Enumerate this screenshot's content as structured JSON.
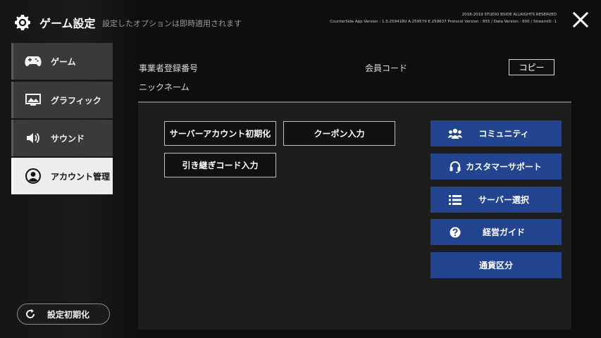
{
  "header": {
    "title": "ゲーム設定",
    "subtitle": "設定したオプションは即時適用されます",
    "copyright": "2018-2019 STUDIO BSIDE ALLRIGHTS RESERVED",
    "version": "CounterSide App Version : 1.0.259418U A.259579 E.259637 Protocol Version : 855 / Data Version : 600 / StreamID -1"
  },
  "sidebar": {
    "items": [
      {
        "label": "ゲーム",
        "icon": "gamepad-icon"
      },
      {
        "label": "グラフィック",
        "icon": "monitor-icon"
      },
      {
        "label": "サウンド",
        "icon": "speaker-icon"
      },
      {
        "label": "アカウント管理",
        "icon": "account-icon",
        "active": true
      }
    ],
    "reset_label": "設定初期化"
  },
  "account": {
    "business_number_label": "事業者登録番号",
    "member_code_label": "会員コード",
    "nickname_label": "ニックネーム",
    "copy_label": "コピー"
  },
  "actions": {
    "server_account_reset": "サーバーアカウント初期化",
    "coupon_input": "クーポン入力",
    "transfer_code_input": "引き継ぎコード入力"
  },
  "links": [
    {
      "label": "コミュニティ",
      "icon": "community-icon"
    },
    {
      "label": "カスタマーサポート",
      "icon": "headset-icon"
    },
    {
      "label": "サーバー選択",
      "icon": "list-icon"
    },
    {
      "label": "経営ガイド",
      "icon": "question-icon"
    },
    {
      "label": "通貨区分",
      "icon": ""
    }
  ],
  "colors": {
    "accent_blue": "#23458f",
    "active_tab": "#ededed",
    "tab_bg": "#3a3a3a"
  }
}
